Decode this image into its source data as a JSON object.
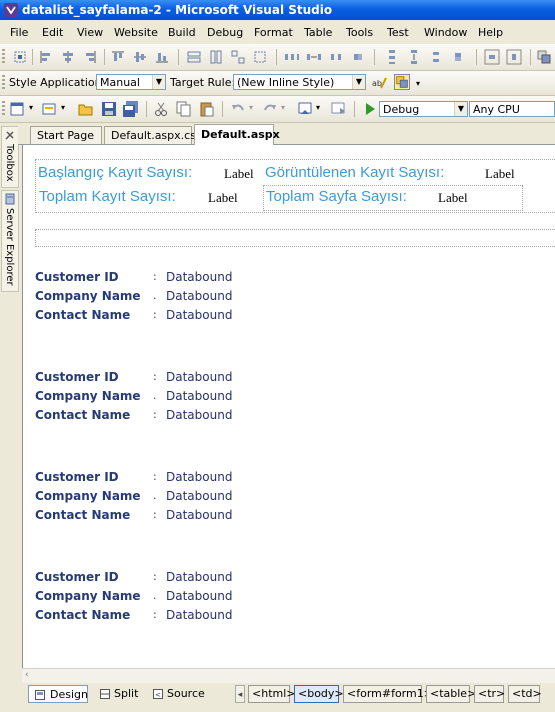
{
  "window": {
    "title": "datalist_sayfalama-2 - Microsoft Visual Studio"
  },
  "menu": [
    "File",
    "Edit",
    "View",
    "Website",
    "Build",
    "Debug",
    "Format",
    "Table",
    "Tools",
    "Test",
    "Window",
    "Help"
  ],
  "style_toolbar": {
    "style_application_label": "Style Application:",
    "style_application_value": "Manual",
    "target_rule_label": "Target Rule:",
    "target_rule_value": "(New Inline Style)"
  },
  "standard_toolbar": {
    "config_value": "Debug",
    "platform_value": "Any CPU"
  },
  "side_tabs": [
    "Toolbox",
    "Server Explorer"
  ],
  "doc_tabs": [
    {
      "label": "Start Page",
      "active": false
    },
    {
      "label": "Default.aspx.cs",
      "active": false
    },
    {
      "label": "Default.aspx",
      "active": true
    }
  ],
  "header": {
    "start_record_label": "Başlangıç Kayıt Sayısı:",
    "start_record_value": "Label",
    "shown_records_label": "Görüntülenen Kayıt Sayısı:",
    "shown_records_value": "Label",
    "total_records_label": "Toplam Kayıt Sayısı:",
    "total_records_value": "Label",
    "total_pages_label": "Toplam Sayfa Sayısı:",
    "total_pages_value": "Label"
  },
  "records": [
    {
      "fields": [
        {
          "label": "Customer ID",
          "sep": ":",
          "value": "Databound"
        },
        {
          "label": "Company Name",
          "sep": ".",
          "value": "Databound"
        },
        {
          "label": "Contact Name",
          "sep": ":",
          "value": "Databound"
        }
      ]
    },
    {
      "fields": [
        {
          "label": "Customer ID",
          "sep": ":",
          "value": "Databound"
        },
        {
          "label": "Company Name",
          "sep": ".",
          "value": "Databound"
        },
        {
          "label": "Contact Name",
          "sep": ":",
          "value": "Databound"
        }
      ]
    },
    {
      "fields": [
        {
          "label": "Customer ID",
          "sep": ":",
          "value": "Databound"
        },
        {
          "label": "Company Name",
          "sep": ".",
          "value": "Databound"
        },
        {
          "label": "Contact Name",
          "sep": ":",
          "value": "Databound"
        }
      ]
    },
    {
      "fields": [
        {
          "label": "Customer ID",
          "sep": ":",
          "value": "Databound"
        },
        {
          "label": "Company Name",
          "sep": ".",
          "value": "Databound"
        },
        {
          "label": "Contact Name",
          "sep": ":",
          "value": "Databound"
        }
      ]
    }
  ],
  "view_buttons": [
    {
      "label": "Design",
      "icon": "design-view-icon",
      "active": true
    },
    {
      "label": "Split",
      "icon": "split-view-icon",
      "active": false
    },
    {
      "label": "Source",
      "icon": "source-view-icon",
      "active": false
    }
  ],
  "tag_path": [
    {
      "label": "<html>",
      "selected": false
    },
    {
      "label": "<body>",
      "selected": true
    },
    {
      "label": "<form#form1>",
      "selected": false
    },
    {
      "label": "<table>",
      "selected": false
    },
    {
      "label": "<tr>",
      "selected": false
    },
    {
      "label": "<td>",
      "selected": false
    }
  ],
  "colors": {
    "title_bar": "#0a5fe0",
    "heading_text": "#3c9bd9",
    "field_label": "#263a78"
  }
}
